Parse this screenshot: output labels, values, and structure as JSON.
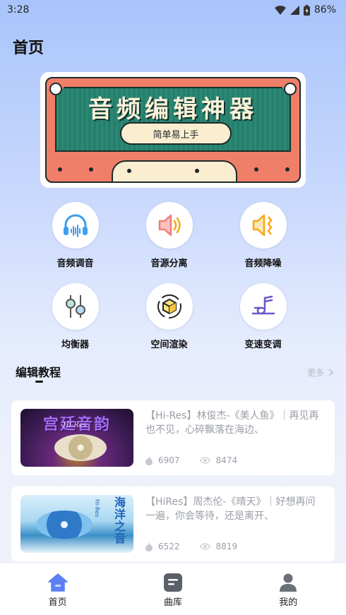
{
  "status_bar": {
    "time": "3:28",
    "battery": "86%"
  },
  "header": {
    "title": "首页"
  },
  "banner": {
    "title": "音频编辑神器",
    "subtitle": "简单易上手"
  },
  "tools": [
    {
      "label": "音频调音",
      "icon": "headphones-icon"
    },
    {
      "label": "音源分离",
      "icon": "speaker-icon"
    },
    {
      "label": "音频降噪",
      "icon": "noise-reduction-icon"
    },
    {
      "label": "均衡器",
      "icon": "equalizer-icon"
    },
    {
      "label": "空间渲染",
      "icon": "spatial-box-icon"
    },
    {
      "label": "变速变调",
      "icon": "pitch-icon"
    }
  ],
  "tutorials": {
    "title": "编辑教程",
    "more": "更多",
    "items": [
      {
        "title": "【Hi-Res】林俊杰-《美人鱼》｜再见再也不见，心碎飘落在海边、",
        "likes": "6907",
        "views": "8474",
        "thumb_text": "宫廷音韵",
        "thumb_sub": "Hi-Res"
      },
      {
        "title": "【HiRes】周杰伦-《晴天》｜好想再问一遍，你会等待，还是离开、",
        "likes": "6522",
        "views": "8819",
        "thumb_text": "海洋之音",
        "thumb_sub": "Hi-Res"
      }
    ]
  },
  "tabbar": [
    {
      "label": "首页",
      "icon": "home-icon",
      "active": true
    },
    {
      "label": "曲库",
      "icon": "library-icon",
      "active": false
    },
    {
      "label": "我的",
      "icon": "profile-icon",
      "active": false
    }
  ],
  "colors": {
    "accent": "#5b7ff5",
    "tool_blue": "#3b9ef2",
    "tool_red": "#ee7c7c",
    "tool_orange": "#f5a816",
    "tool_purple": "#6a58c7"
  }
}
